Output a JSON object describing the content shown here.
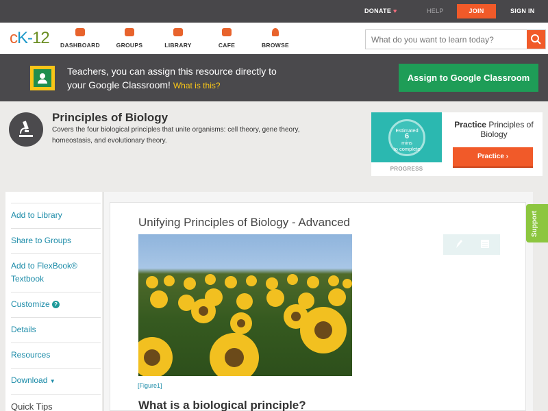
{
  "topbar": {
    "donate": "DONATE",
    "help": "HELP",
    "join": "JOIN",
    "signin": "SIGN IN"
  },
  "logo": {
    "c": "c",
    "k": "K-",
    "n": "12"
  },
  "nav": [
    {
      "label": "DASHBOARD",
      "icon": "dashboard-icon"
    },
    {
      "label": "GROUPS",
      "icon": "groups-icon"
    },
    {
      "label": "LIBRARY",
      "icon": "library-icon"
    },
    {
      "label": "CAFE",
      "icon": "cafe-icon"
    },
    {
      "label": "BROWSE",
      "icon": "browse-icon"
    }
  ],
  "search": {
    "placeholder": "What do you want to learn today?"
  },
  "classroom_banner": {
    "line1": "Teachers, you can assign this resource directly to",
    "line2": "your Google Classroom!",
    "what_link": "What is this?",
    "button": "Assign to Google Classroom"
  },
  "module": {
    "title": "Principles of Biology",
    "description": "Covers the four biological principles that unite organisms: cell theory, gene theory, homeostasis, and evolutionary theory."
  },
  "practice": {
    "est1": "Estimated",
    "est_n": "6",
    "est2": "mins",
    "est3": "to complete",
    "progress_label": "PROGRESS",
    "text_bold": "Practice",
    "text_rest": "Principles of Biology",
    "button": "Practice"
  },
  "sidebar": {
    "items": [
      {
        "label": "Add to Library"
      },
      {
        "label": "Share to Groups"
      },
      {
        "label": "Add to FlexBook® Textbook"
      },
      {
        "label": "Customize"
      },
      {
        "label": "Details"
      },
      {
        "label": "Resources"
      },
      {
        "label": "Download"
      },
      {
        "label": "Quick Tips"
      }
    ]
  },
  "content": {
    "title": "Unifying Principles of Biology - Advanced",
    "figure_caption": "[Figure1]",
    "heading": "What is a biological principle?"
  },
  "support_tab": "Support",
  "colors": {
    "accent": "#f15a29",
    "green": "#1e9d57",
    "link": "#1b8ba8",
    "topbar": "#48474a"
  }
}
